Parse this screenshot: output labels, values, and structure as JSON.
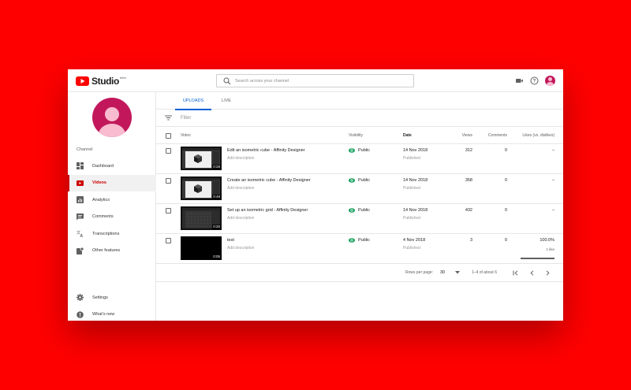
{
  "colors": {
    "background": "#ff0000",
    "accent": "#cc0000",
    "tab_accent": "#065fd4",
    "public": "#0f9d58",
    "avatar": "#c2185b"
  },
  "app": {
    "logo_text": "Studio",
    "logo_superscript": "beta"
  },
  "search": {
    "placeholder": "Search across your channel",
    "icon": "search-icon"
  },
  "header_icons": [
    "video-camera-icon",
    "help-icon",
    "avatar"
  ],
  "sidebar": {
    "section_label": "Channel",
    "items": [
      {
        "label": "Dashboard",
        "icon": "dashboard-icon",
        "active": false
      },
      {
        "label": "Videos",
        "icon": "videos-icon",
        "active": true
      },
      {
        "label": "Analytics",
        "icon": "analytics-icon",
        "active": false
      },
      {
        "label": "Comments",
        "icon": "comments-icon",
        "active": false
      },
      {
        "label": "Transcriptions",
        "icon": "translate-icon",
        "active": false
      },
      {
        "label": "Other features",
        "icon": "other-features-icon",
        "active": false
      }
    ],
    "bottom_items": [
      {
        "label": "Settings",
        "icon": "gear-icon"
      },
      {
        "label": "What's new",
        "icon": "info-icon"
      }
    ]
  },
  "tabs": [
    {
      "label": "UPLOADS",
      "active": true
    },
    {
      "label": "LIVE",
      "active": false
    }
  ],
  "filter": {
    "label": "Filter"
  },
  "table": {
    "columns": {
      "video": "Video",
      "visibility": "Visibility",
      "date": "Date",
      "views": "Views",
      "comments": "Comments",
      "likes": "Likes (vs. dislikes)"
    },
    "rows": [
      {
        "title": "Edit an isometric cube - Affinity Designer",
        "description": "Add description",
        "duration": "0:28",
        "visibility": "Public",
        "date": "14 Nov 2018",
        "status": "Published",
        "views": "312",
        "comments": "0",
        "likes": "–"
      },
      {
        "title": "Create an isometric cube - Affinity Designer",
        "description": "Add description",
        "duration": "0:49",
        "visibility": "Public",
        "date": "14 Nov 2018",
        "status": "Published",
        "views": "358",
        "comments": "0",
        "likes": "–"
      },
      {
        "title": "Set up an isometric grid - Affinity Designer",
        "description": "Add description",
        "duration": "0:20",
        "visibility": "Public",
        "date": "14 Nov 2018",
        "status": "Published",
        "views": "432",
        "comments": "0",
        "likes": "–"
      },
      {
        "title": "test",
        "description": "Add description",
        "duration": "0:05",
        "visibility": "Public",
        "date": "4 Nov 2018",
        "status": "Published",
        "views": "3",
        "comments": "0",
        "likes": "100.0%",
        "likes_count": "1 like"
      }
    ]
  },
  "pagination": {
    "rows_per_page_label": "Rows per page:",
    "rows_per_page": "30",
    "range": "1–4 of about 6"
  }
}
